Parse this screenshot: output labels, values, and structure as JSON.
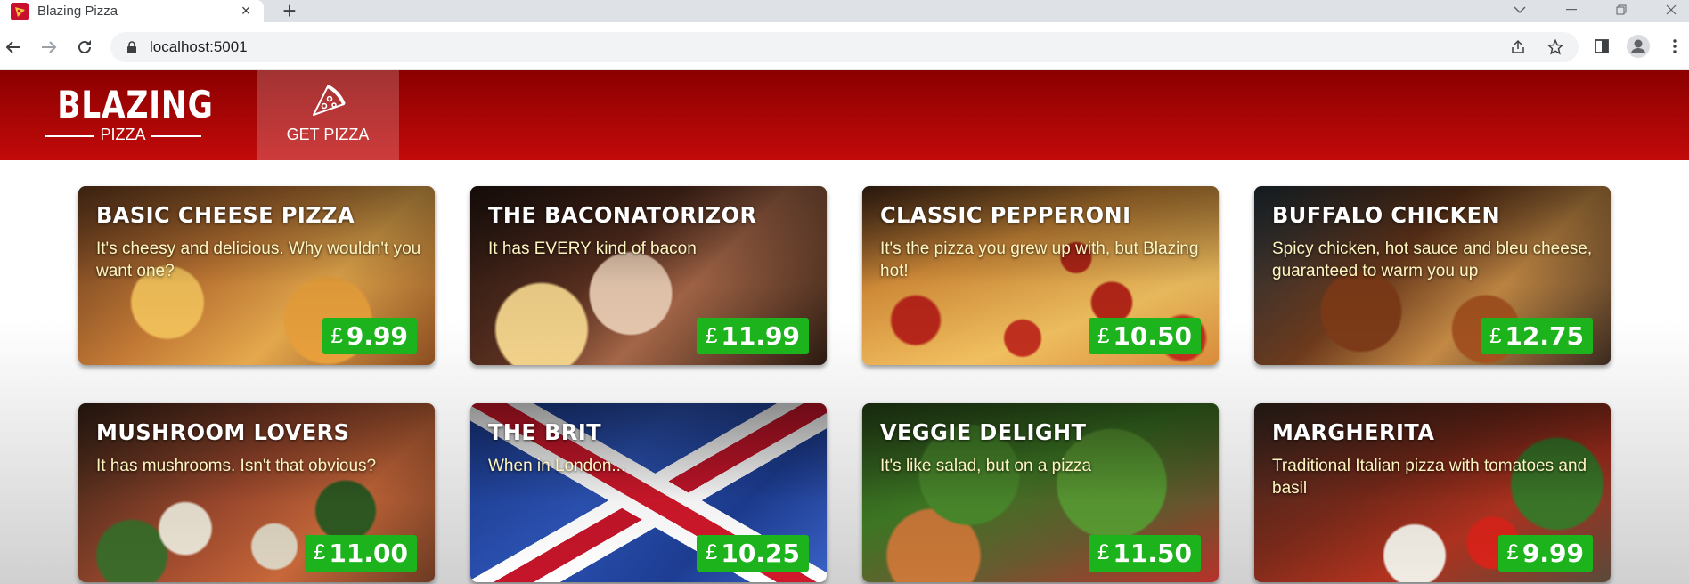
{
  "browser": {
    "tab_title": "Blazing Pizza",
    "new_tab": "+",
    "tab_close": "×",
    "url": "localhost:5001"
  },
  "header": {
    "logo_main": "BLAZING",
    "logo_sub": "PIZZA",
    "nav_label": "GET PIZZA"
  },
  "pizzas": [
    {
      "name": "BASIC CHEESE PIZZA",
      "description": "It's cheesy and delicious. Why wouldn't you want one?",
      "currency": "£",
      "price": "9.99"
    },
    {
      "name": "THE BACONATORIZOR",
      "description": "It has EVERY kind of bacon",
      "currency": "£",
      "price": "11.99"
    },
    {
      "name": "CLASSIC PEPPERONI",
      "description": "It's the pizza you grew up with, but Blazing hot!",
      "currency": "£",
      "price": "10.50"
    },
    {
      "name": "BUFFALO CHICKEN",
      "description": "Spicy chicken, hot sauce and bleu cheese, guaranteed to warm you up",
      "currency": "£",
      "price": "12.75"
    },
    {
      "name": "MUSHROOM LOVERS",
      "description": "It has mushrooms. Isn't that obvious?",
      "currency": "£",
      "price": "11.00"
    },
    {
      "name": "THE BRIT",
      "description": "When in London...",
      "currency": "£",
      "price": "10.25"
    },
    {
      "name": "VEGGIE DELIGHT",
      "description": "It's like salad, but on a pizza",
      "currency": "£",
      "price": "11.50"
    },
    {
      "name": "MARGHERITA",
      "description": "Traditional Italian pizza with tomatoes and basil",
      "currency": "£",
      "price": "9.99"
    }
  ],
  "colors": {
    "header_dark": "#8b0000",
    "header_light": "#c20a0a",
    "price_badge": "#1db31d",
    "description_text": "#fff5c0"
  }
}
